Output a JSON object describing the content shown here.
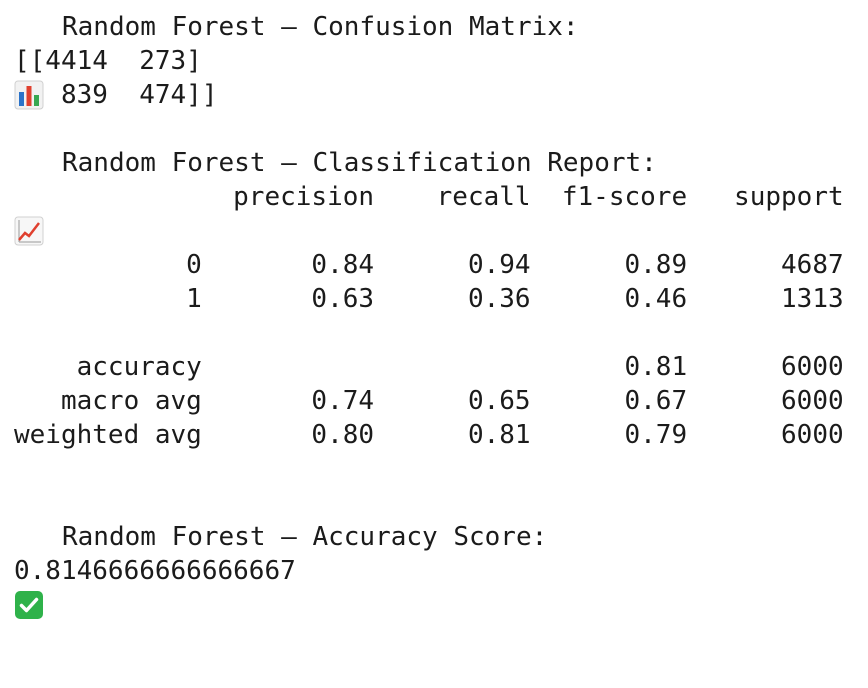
{
  "sections": {
    "confusion_matrix": {
      "icon": "bar-chart-icon",
      "title": "Random Forest – Confusion Matrix:",
      "rows": [
        "[[4414  273]",
        " [ 839  474]]"
      ]
    },
    "classification_report": {
      "icon": "chart-increasing-icon",
      "title": "Random Forest – Classification Report:",
      "header": "              precision    recall  f1-score   support",
      "class_rows": [
        "           0       0.84      0.94      0.89      4687",
        "           1       0.63      0.36      0.46      1313"
      ],
      "summary_rows": [
        "    accuracy                           0.81      6000",
        "   macro avg       0.74      0.65      0.67      6000",
        "weighted avg       0.80      0.81      0.79      6000"
      ]
    },
    "accuracy_score": {
      "icon": "check-mark-button-icon",
      "title": "Random Forest – Accuracy Score:",
      "value": "0.8146666666666667"
    }
  },
  "colors": {
    "text": "#1b1b1b",
    "check_green": "#2fb24a",
    "bar_blue": "#2b73c9",
    "bar_red": "#e0402f",
    "bar_green": "#38a852"
  }
}
